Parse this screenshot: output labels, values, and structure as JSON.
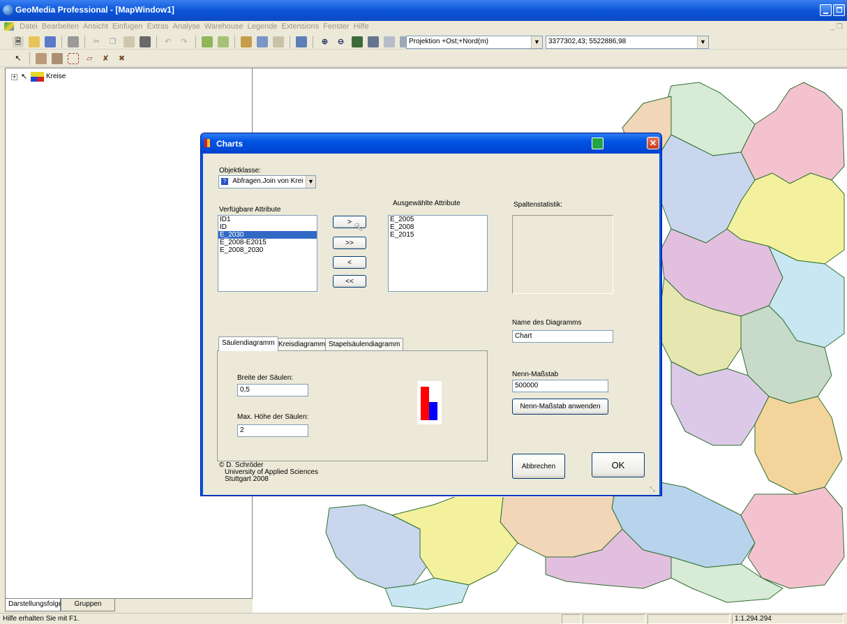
{
  "window": {
    "title": "GeoMedia Professional - [MapWindow1]"
  },
  "menu": {
    "items": [
      "Datei",
      "Bearbeiten",
      "Ansicht",
      "Einfügen",
      "Extras",
      "Analyse",
      "Warehouse",
      "Legende",
      "Extensions",
      "Fenster",
      "Hilfe"
    ]
  },
  "toolbar": {
    "projection_value": "Projektion +Ost;+Nord(m)",
    "coordinates_value": "3377302,43; 5522886,98"
  },
  "legend": {
    "layer_name": "Kreise"
  },
  "panel_tabs": {
    "tab1": "Darstellungsfolge",
    "tab2": "Gruppen"
  },
  "statusbar": {
    "help_text": "Hilfe erhalten Sie mit F1.",
    "scale": "1:1.294.294"
  },
  "dialog": {
    "title": "Charts",
    "object_class_label": "Objektklasse:",
    "object_class_value": "Abfragen.Join von Krei",
    "available_label": "Verfügbare Attribute",
    "available_items": [
      "ID1",
      "ID",
      "E_2030",
      "E_2008-E2015",
      "E_2008_2030"
    ],
    "selected_label": "Ausgewählte Attribute",
    "selected_items": [
      "E_2005",
      "E_2008",
      "E_2015"
    ],
    "stats_label": "Spaltenstatistik:",
    "move_buttons": {
      "add": ">",
      "add_all": ">>",
      "remove": "<",
      "remove_all": "<<"
    },
    "tabs": [
      "Säulendiagramm",
      "Kreisdiagramm",
      "Stapelsäulendiagramm"
    ],
    "bar_width_label": "Breite der Säulen:",
    "bar_width_value": "0,5",
    "bar_height_label": "Max. Höhe der Säulen:",
    "bar_height_value": "2",
    "chart_name_label": "Name des Diagramms",
    "chart_name_value": "Chart",
    "scale_label": "Nenn-Maßstab",
    "scale_value": "500000",
    "apply_scale_button": "Nenn-Maßstab anwenden",
    "credit_line1": "© D. Schröder",
    "credit_line2": "University of Applied Sciences",
    "credit_line3": "Stuttgart 2008",
    "cancel_button": "Abbrechen",
    "ok_button": "OK",
    "preview_colors": {
      "red": "#ff0000",
      "blue": "#0000ff"
    }
  },
  "map_colors": [
    "#f4c2cf",
    "#d7ebd6",
    "#f1d6b8",
    "#c9d6ee",
    "#f3f19e",
    "#e3bfdf",
    "#c9e7f2",
    "#e6e7b0",
    "#c8dac9",
    "#dcc9e8",
    "#f3d59b",
    "#b8d3ec"
  ]
}
